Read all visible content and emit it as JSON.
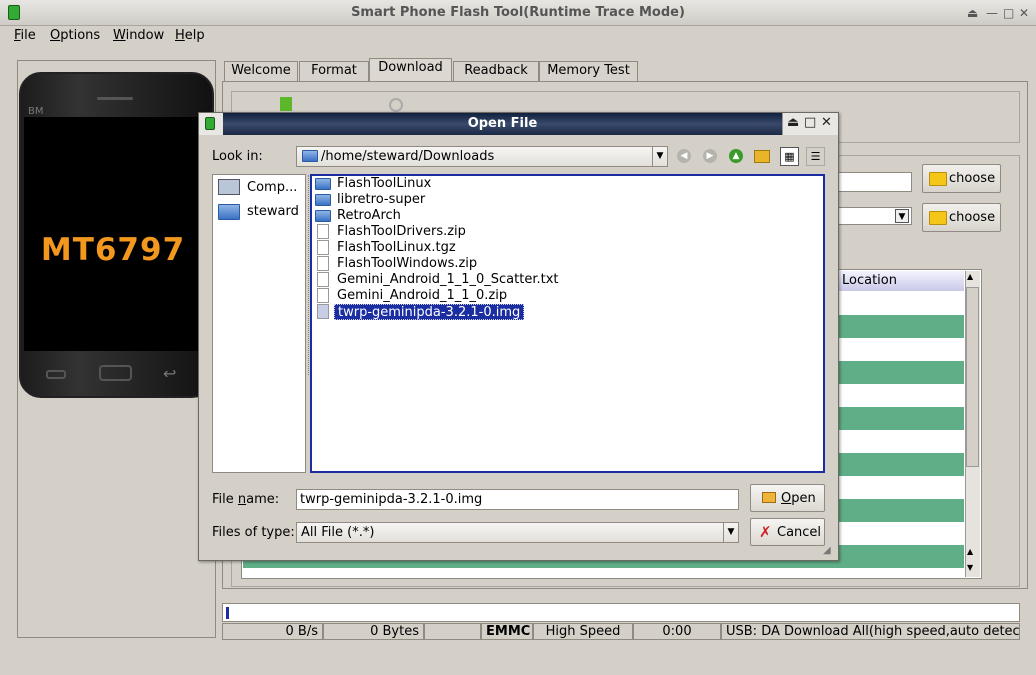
{
  "window": {
    "title": "Smart Phone Flash Tool(Runtime Trace Mode)"
  },
  "menu": [
    {
      "key": "F",
      "rest": "ile"
    },
    {
      "key": "O",
      "rest": "ptions"
    },
    {
      "key": "W",
      "rest": "indow"
    },
    {
      "key": "H",
      "rest": "elp"
    }
  ],
  "phone": {
    "chip": "MT6797",
    "brand": "BM"
  },
  "tabs": [
    "Welcome",
    "Format",
    "Download",
    "Readback",
    "Memory Test"
  ],
  "active_tab": "Download",
  "download": {
    "choose_label": "choose",
    "table_header_location": "Location",
    "row_colors": {
      "white": "#ffffff",
      "green": "#5fae87"
    }
  },
  "status": {
    "speed": "0 B/s",
    "bytes": "0 Bytes",
    "storage": "EMMC",
    "mode": "High Speed",
    "time": "0:00",
    "message": "USB: DA Download All(high speed,auto detect)",
    "progress": 0
  },
  "dialog": {
    "title": "Open File",
    "look_in_label": "Look in:",
    "look_in_value": "/home/steward/Downloads",
    "places": [
      "Comp...",
      "steward"
    ],
    "files": [
      {
        "name": "FlashToolLinux",
        "kind": "folder"
      },
      {
        "name": "libretro-super",
        "kind": "folder"
      },
      {
        "name": "RetroArch",
        "kind": "folder"
      },
      {
        "name": "FlashToolDrivers.zip",
        "kind": "file"
      },
      {
        "name": "FlashToolLinux.tgz",
        "kind": "file"
      },
      {
        "name": "FlashToolWindows.zip",
        "kind": "file"
      },
      {
        "name": "Gemini_Android_1_1_0_Scatter.txt",
        "kind": "file"
      },
      {
        "name": "Gemini_Android_1_1_0.zip",
        "kind": "file"
      },
      {
        "name": "twrp-geminipda-3.2.1-0.img",
        "kind": "file",
        "selected": true
      }
    ],
    "file_name_label_pre": "File ",
    "file_name_label_key": "n",
    "file_name_label_post": "ame:",
    "file_name_value": "twrp-geminipda-3.2.1-0.img",
    "file_type_label": "Files of type:",
    "file_type_value": "All File (*.*)",
    "open_label_key": "O",
    "open_label_rest": "pen",
    "cancel_label": "Cancel"
  },
  "colors": {
    "selection": "#1b2ea1",
    "chip_text": "#f3981f",
    "folder": "#f5c518"
  }
}
